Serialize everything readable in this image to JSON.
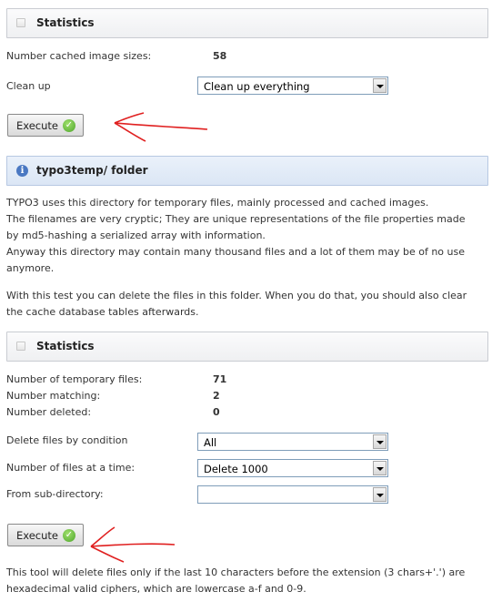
{
  "section1": {
    "stats_title": "Statistics",
    "cached_label": "Number cached image sizes:",
    "cached_value": "58",
    "cleanup_label": "Clean up",
    "cleanup_select": "Clean up everything",
    "execute_label": "Execute"
  },
  "section2": {
    "title": "typo3temp/ folder",
    "para1": [
      "TYPO3 uses this directory for temporary files, mainly processed and cached images.",
      "The filenames are very cryptic; They are unique representations of the file properties made",
      "by md5-hashing a serialized array with information.",
      "Anyway this directory may contain many thousand files and a lot of them may be of no use",
      "anymore."
    ],
    "para2": [
      "With this test you can delete the files in this folder. When you do that, you should also clear",
      "the cache database tables afterwards."
    ],
    "stats_title": "Statistics",
    "temp_files_label": "Number of temporary files:",
    "temp_files_value": "71",
    "matching_label": "Number matching:",
    "matching_value": "2",
    "deleted_label": "Number deleted:",
    "deleted_value": "0",
    "delete_condition_label": "Delete files by condition",
    "delete_condition_select": "All",
    "files_at_time_label": "Number of files at a time:",
    "files_at_time_select": "Delete 1000",
    "subdir_label": "From sub-directory:",
    "subdir_select": "",
    "execute_label": "Execute",
    "footer_note": [
      "This tool will delete files only if the last 10 characters before the extension (3 chars+'.') are",
      "hexadecimal valid ciphers, which are lowercase a-f and 0-9."
    ]
  },
  "colors": {
    "annotation_arrow": "#e02020",
    "info_accent": "#4a78c2",
    "ok_green": "#4ea52d"
  }
}
